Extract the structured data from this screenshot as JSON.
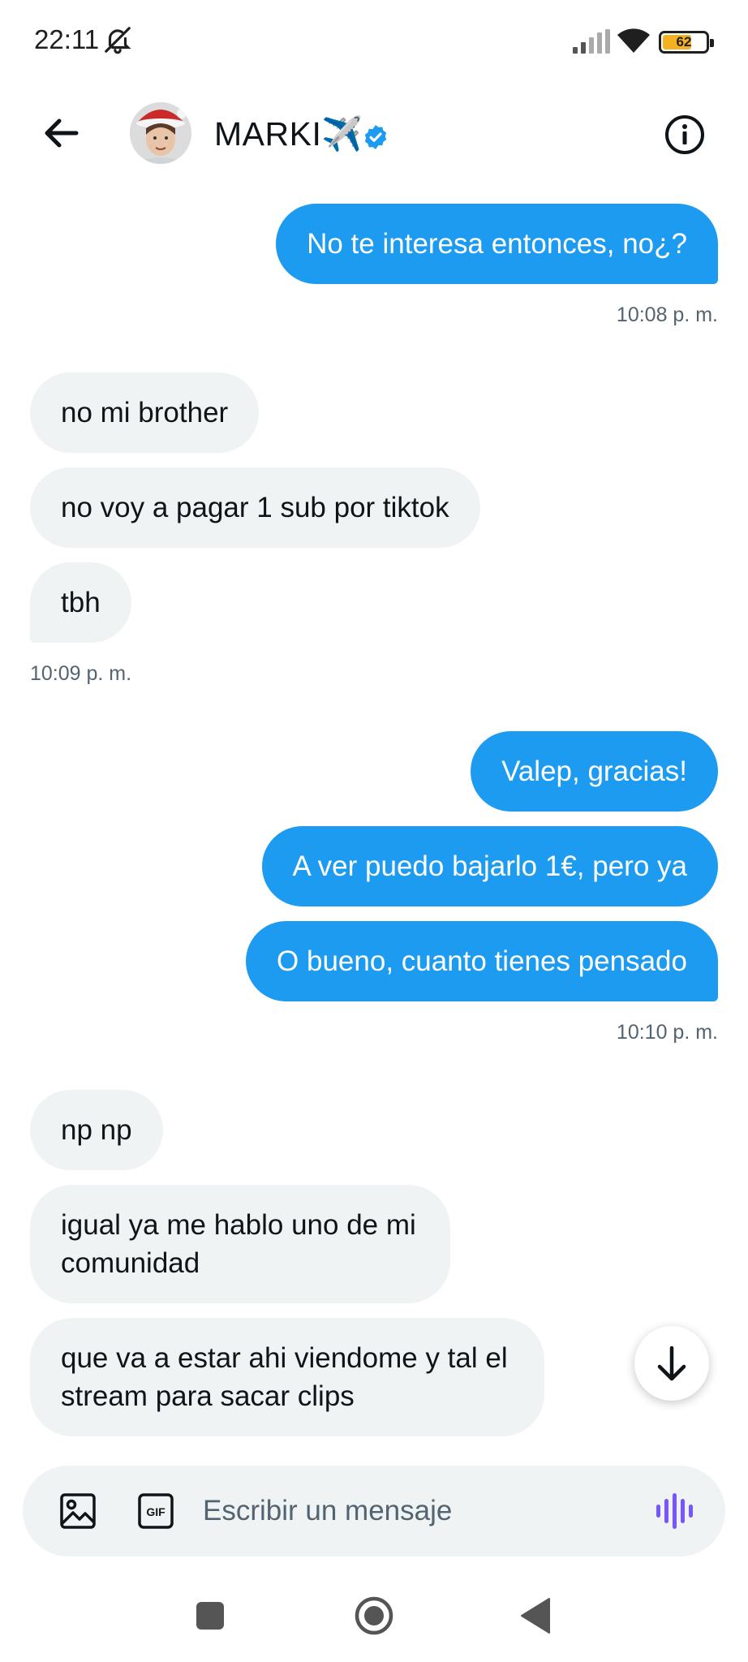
{
  "status_bar": {
    "time": "22:11",
    "battery": "62"
  },
  "header": {
    "contact_name": "MARKI✈️"
  },
  "messages": [
    {
      "dir": "out",
      "text": "No te interesa entonces, no¿?"
    },
    {
      "dir": "stamp",
      "text": "10:08 p. m."
    },
    {
      "dir": "in",
      "text": "no mi brother"
    },
    {
      "dir": "in",
      "text": "no voy a pagar 1 sub por tiktok"
    },
    {
      "dir": "in",
      "text": "tbh"
    },
    {
      "dir": "stamp",
      "text": "10:09 p. m."
    },
    {
      "dir": "out",
      "text": "Valep, gracias!"
    },
    {
      "dir": "out",
      "text": "A ver puedo bajarlo 1€, pero ya"
    },
    {
      "dir": "out",
      "text": "O bueno, cuanto tienes pensado"
    },
    {
      "dir": "stamp",
      "text": "10:10 p. m."
    },
    {
      "dir": "in",
      "text": "np np"
    },
    {
      "dir": "in",
      "text": "igual ya me hablo uno de mi comunidad"
    },
    {
      "dir": "in",
      "text": "que va a estar ahi viendome y tal el stream para sacar clips"
    }
  ],
  "composer": {
    "placeholder": "Escribir un mensaje",
    "value": ""
  },
  "colors": {
    "accent": "#1d9bf0",
    "incoming_bubble": "#eff3f4",
    "voice_icon": "#7856ff"
  }
}
